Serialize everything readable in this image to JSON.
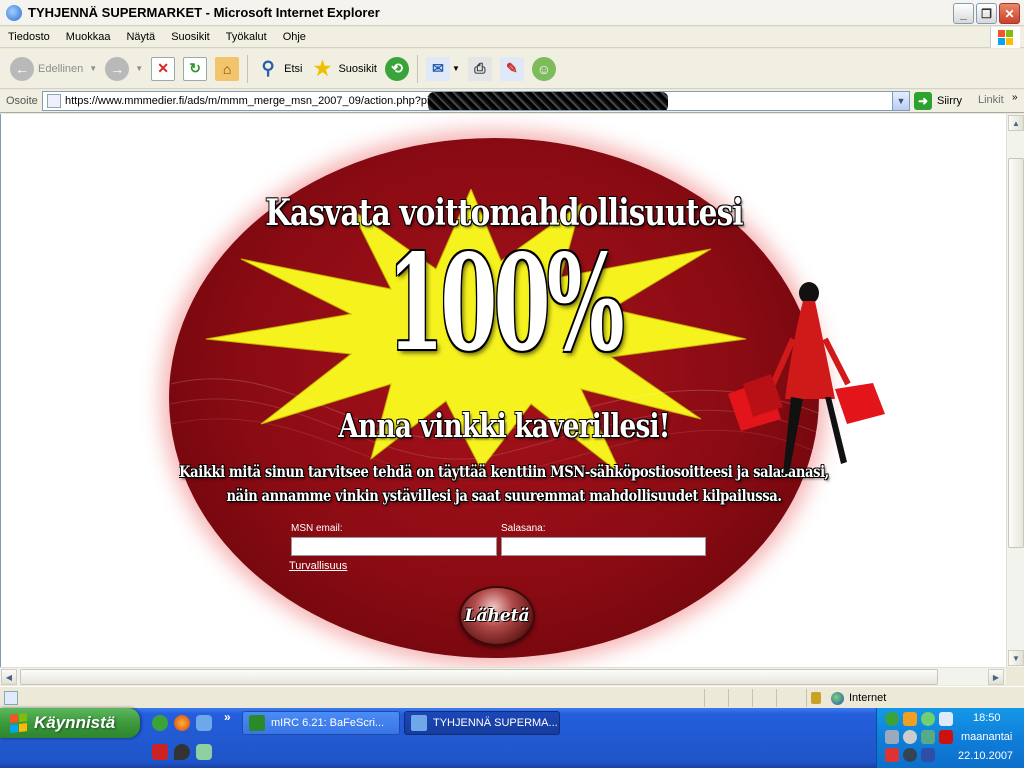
{
  "window": {
    "title": "TYHJENNÄ SUPERMARKET - Microsoft Internet Explorer",
    "minimize": "_",
    "maximize": "❐",
    "close": "✕"
  },
  "menu": [
    "Tiedosto",
    "Muokkaa",
    "Näytä",
    "Suosikit",
    "Työkalut",
    "Ohje"
  ],
  "toolbar": {
    "back_label": "Edellinen",
    "search_label": "Etsi",
    "favorites_label": "Suosikit"
  },
  "address": {
    "label": "Osoite",
    "url": "https://www.mmmedier.fi/ads/m/mmm_merge_msn_2007_09/action.php?pi",
    "go_label": "Siirry",
    "links_label": "Linkit"
  },
  "ad": {
    "headline": "Kasvata voittomahdollisuutesi",
    "percent": "100%",
    "subhead": "Anna vinkki kaverillesi!",
    "description_line1": "Kaikki mitä sinun tarvitsee tehdä on täyttää kenttiin MSN-sähköpostiosoitteesi ja salasanasi,",
    "description_line2": "näin annamme vinkin ystävillesi ja saat suuremmat mahdollisuudet kilpailussa.",
    "email_label": "MSN email:",
    "email_value": "",
    "password_label": "Salasana:",
    "password_value": "",
    "security_link": "Turvallisuus",
    "submit_label": "Lähetä"
  },
  "status": {
    "zone": "Internet"
  },
  "taskbar": {
    "start_label": "Käynnistä",
    "more": "»",
    "tasks": [
      {
        "label": "mIRC 6.21: BaFeScri..."
      },
      {
        "label": "TYHJENNÄ SUPERMA..."
      }
    ],
    "clock": "18:50",
    "weekday": "maanantai",
    "date": "22.10.2007"
  },
  "colors": {
    "oval_red": "#8a0b13",
    "starburst_yellow": "#f5f21e",
    "taskbar_blue": "#245edb",
    "start_green": "#3c993c"
  }
}
